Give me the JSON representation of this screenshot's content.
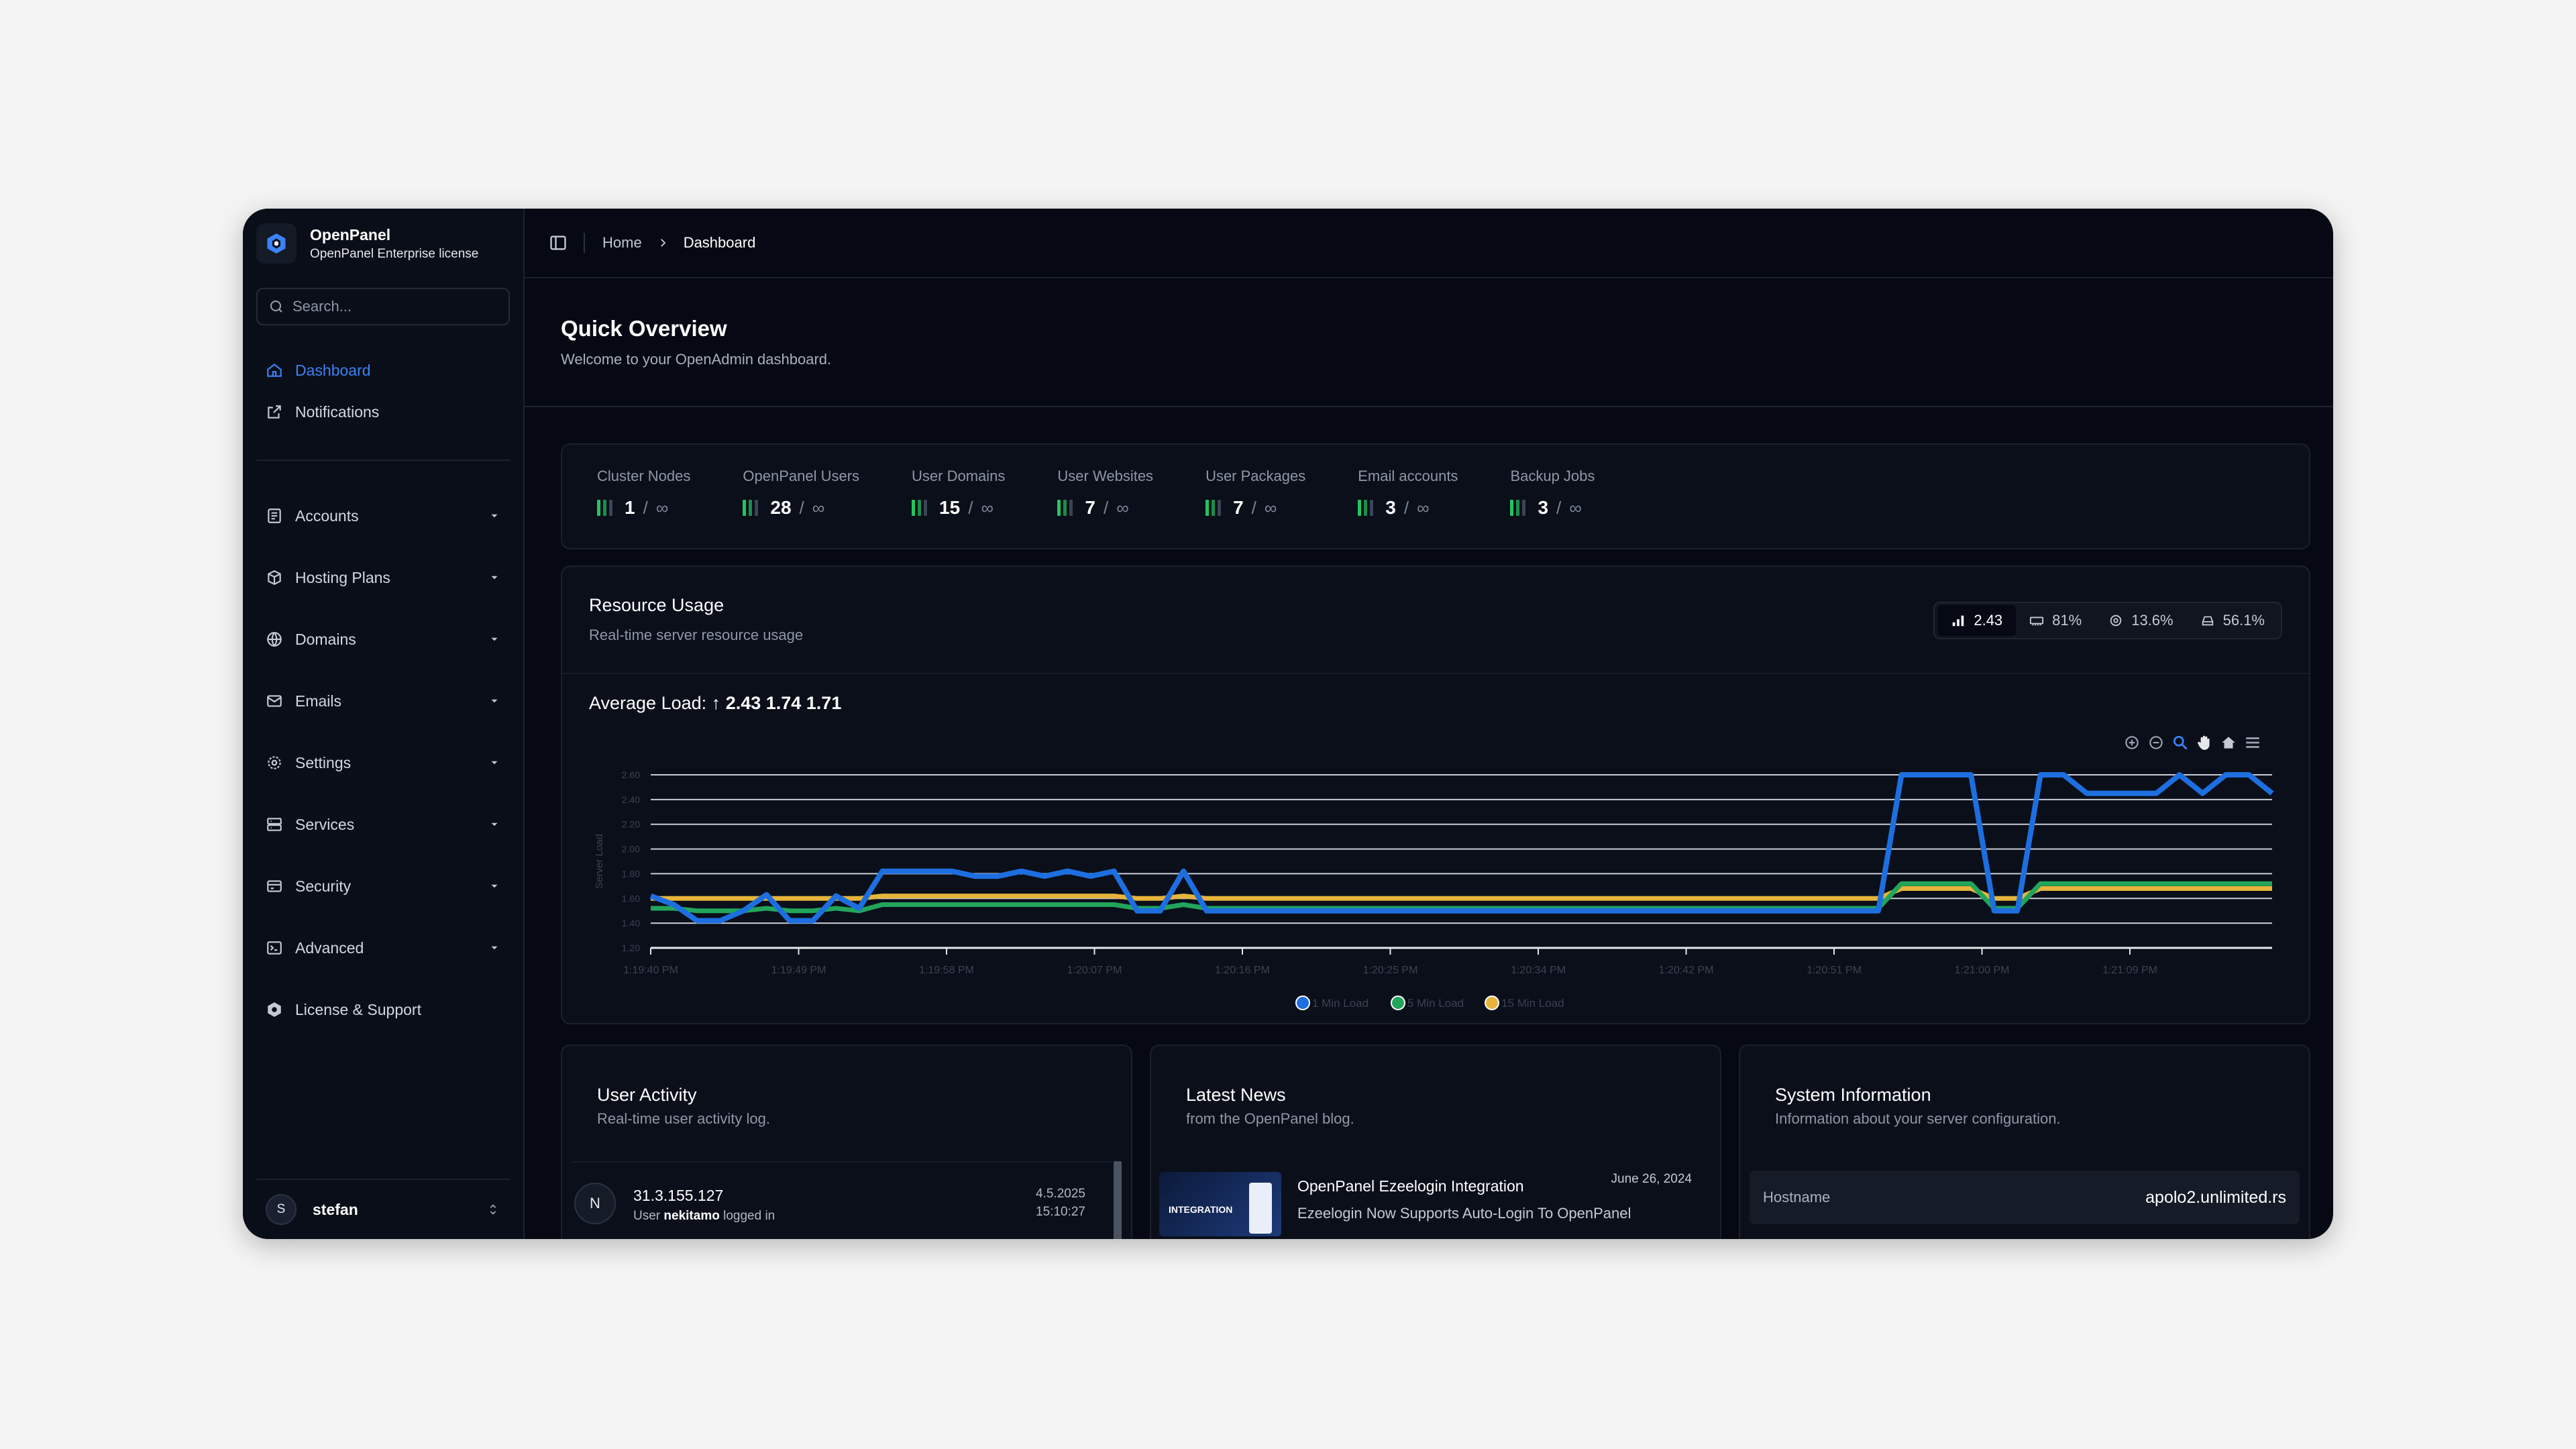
{
  "brand": {
    "name": "OpenPanel",
    "license": "OpenPanel Enterprise license"
  },
  "search": {
    "placeholder": "Search..."
  },
  "sidebar": {
    "items": [
      {
        "label": "Dashboard",
        "icon": "home-icon",
        "active": true
      },
      {
        "label": "Notifications",
        "icon": "external-link-icon"
      },
      {
        "label": "Accounts",
        "icon": "accounts-icon"
      },
      {
        "label": "Hosting Plans",
        "icon": "package-icon"
      },
      {
        "label": "Domains",
        "icon": "globe-icon"
      },
      {
        "label": "Emails",
        "icon": "mail-icon"
      },
      {
        "label": "Settings",
        "icon": "gear-icon"
      },
      {
        "label": "Services",
        "icon": "server-icon"
      },
      {
        "label": "Security",
        "icon": "security-icon"
      },
      {
        "label": "Advanced",
        "icon": "terminal-icon"
      },
      {
        "label": "License & Support",
        "icon": "license-icon"
      }
    ]
  },
  "user": {
    "initial": "S",
    "name": "stefan"
  },
  "breadcrumb": {
    "home": "Home",
    "current": "Dashboard"
  },
  "header": {
    "title": "Quick Overview",
    "subtitle": "Welcome to your OpenAdmin dashboard."
  },
  "stats": [
    {
      "label": "Cluster Nodes",
      "value": "1",
      "limit": "∞"
    },
    {
      "label": "OpenPanel Users",
      "value": "28",
      "limit": "∞"
    },
    {
      "label": "User Domains",
      "value": "15",
      "limit": "∞"
    },
    {
      "label": "User Websites",
      "value": "7",
      "limit": "∞"
    },
    {
      "label": "User Packages",
      "value": "7",
      "limit": "∞"
    },
    {
      "label": "Email accounts",
      "value": "3",
      "limit": "∞"
    },
    {
      "label": "Backup Jobs",
      "value": "3",
      "limit": "∞"
    }
  ],
  "resource": {
    "title": "Resource Usage",
    "subtitle": "Real-time server resource usage",
    "metrics": [
      {
        "icon": "load-icon",
        "value": "2.43"
      },
      {
        "icon": "memory-icon",
        "value": "81%"
      },
      {
        "icon": "cpu-icon",
        "value": "13.6%"
      },
      {
        "icon": "disk-icon",
        "value": "56.1%"
      }
    ],
    "avg_label": "Average Load:",
    "avg_arrow": "↑",
    "avg_values": "2.43 1.74 1.71"
  },
  "chart_data": {
    "type": "line",
    "ylabel": "Server Load",
    "ylim": [
      1.2,
      2.6
    ],
    "yticks": [
      "1.20",
      "1.40",
      "1.60",
      "1.80",
      "2.00",
      "2.20",
      "2.40",
      "2.60"
    ],
    "x": [
      "1:19:40 PM",
      "1:19:49 PM",
      "1:19:58 PM",
      "1:20:07 PM",
      "1:20:16 PM",
      "1:20:25 PM",
      "1:20:34 PM",
      "1:20:42 PM",
      "1:20:51 PM",
      "1:21:00 PM",
      "1:21:09 PM"
    ],
    "legend_position": "bottom",
    "colors": [
      "#1d6fe0",
      "#22a55a",
      "#e6b43c"
    ],
    "series": [
      {
        "name": "1 Min Load",
        "values": [
          1.62,
          1.55,
          1.42,
          1.42,
          1.5,
          1.63,
          1.42,
          1.42,
          1.62,
          1.52,
          1.82,
          1.82,
          1.82,
          1.82,
          1.78,
          1.78,
          1.82,
          1.78,
          1.82,
          1.78,
          1.82,
          1.5,
          1.5,
          1.82,
          1.5,
          1.5,
          1.5,
          1.5,
          1.5,
          1.5,
          1.5,
          1.5,
          1.5,
          1.5,
          1.5,
          1.5,
          1.5,
          1.5,
          1.5,
          1.5,
          1.5,
          1.5,
          1.5,
          1.5,
          1.5,
          1.5,
          1.5,
          1.5,
          1.5,
          1.5,
          1.5,
          1.5,
          1.5,
          1.5,
          2.6,
          2.6,
          2.6,
          2.6,
          1.5,
          1.5,
          2.6,
          2.6,
          2.45,
          2.45,
          2.45,
          2.45,
          2.6,
          2.45,
          2.6,
          2.6,
          2.45
        ]
      },
      {
        "name": "5 Min Load",
        "values": [
          1.52,
          1.52,
          1.5,
          1.5,
          1.5,
          1.52,
          1.5,
          1.5,
          1.52,
          1.5,
          1.55,
          1.55,
          1.55,
          1.55,
          1.55,
          1.55,
          1.55,
          1.55,
          1.55,
          1.55,
          1.55,
          1.52,
          1.52,
          1.55,
          1.52,
          1.52,
          1.52,
          1.52,
          1.52,
          1.52,
          1.52,
          1.52,
          1.52,
          1.52,
          1.52,
          1.52,
          1.52,
          1.52,
          1.52,
          1.52,
          1.52,
          1.52,
          1.52,
          1.52,
          1.52,
          1.52,
          1.52,
          1.52,
          1.52,
          1.52,
          1.52,
          1.52,
          1.52,
          1.52,
          1.72,
          1.72,
          1.72,
          1.72,
          1.52,
          1.52,
          1.72,
          1.72,
          1.72,
          1.72,
          1.72,
          1.72,
          1.72,
          1.72,
          1.72,
          1.72,
          1.72
        ]
      },
      {
        "name": "15 Min Load",
        "values": [
          1.6,
          1.6,
          1.6,
          1.6,
          1.6,
          1.6,
          1.6,
          1.6,
          1.6,
          1.6,
          1.62,
          1.62,
          1.62,
          1.62,
          1.62,
          1.62,
          1.62,
          1.62,
          1.62,
          1.62,
          1.62,
          1.6,
          1.6,
          1.62,
          1.6,
          1.6,
          1.6,
          1.6,
          1.6,
          1.6,
          1.6,
          1.6,
          1.6,
          1.6,
          1.6,
          1.6,
          1.6,
          1.6,
          1.6,
          1.6,
          1.6,
          1.6,
          1.6,
          1.6,
          1.6,
          1.6,
          1.6,
          1.6,
          1.6,
          1.6,
          1.6,
          1.6,
          1.6,
          1.6,
          1.68,
          1.68,
          1.68,
          1.68,
          1.6,
          1.6,
          1.68,
          1.68,
          1.68,
          1.68,
          1.68,
          1.68,
          1.68,
          1.68,
          1.68,
          1.68,
          1.68
        ]
      }
    ]
  },
  "activity": {
    "title": "User Activity",
    "subtitle": "Real-time user activity log.",
    "row": {
      "initial": "N",
      "ip": "31.3.155.127",
      "prefix": "User",
      "user": "nekitamo",
      "action": "logged in",
      "date": "4.5.2025",
      "time": "15:10:27"
    }
  },
  "news": {
    "title": "Latest News",
    "subtitle": "from the OpenPanel blog.",
    "item": {
      "title": "OpenPanel Ezeelogin Integration",
      "desc": "Ezeelogin Now Supports Auto-Login To OpenPanel",
      "date": "June 26, 2024",
      "thumb_label": "INTEGRATION"
    }
  },
  "sysinfo": {
    "title": "System Information",
    "subtitle": "Information about your server configuration.",
    "rows": [
      {
        "key": "Hostname",
        "value": "apolo2.unlimited.rs"
      }
    ]
  }
}
